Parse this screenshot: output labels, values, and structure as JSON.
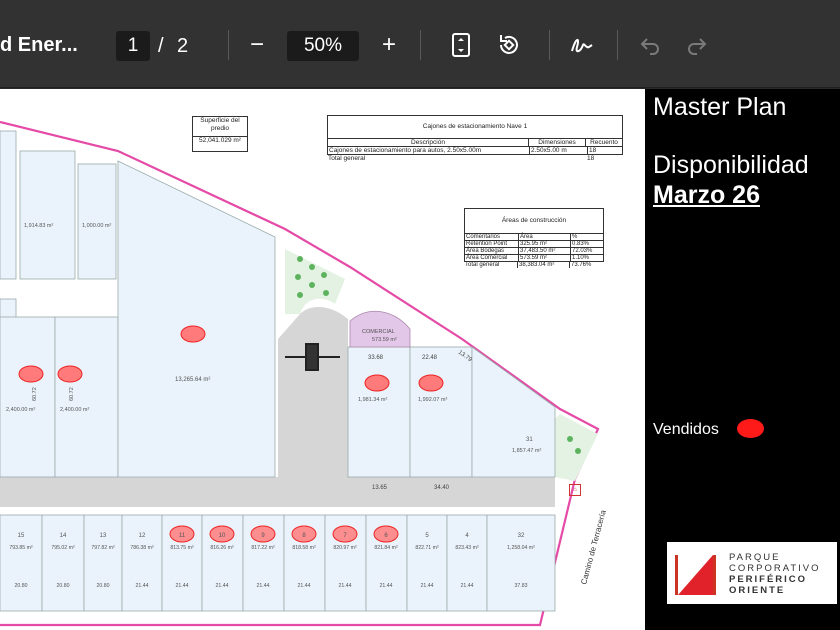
{
  "toolbar": {
    "doc_title": "d Ener...",
    "page_current": "1",
    "page_separator": "/",
    "page_total": "2",
    "zoom_out": "−",
    "zoom": "50%",
    "zoom_in": "+"
  },
  "panel": {
    "title": "Master Plan",
    "availability": "Disponibilidad",
    "date": "Marzo 26",
    "sold_label": "Vendidos",
    "sold_color": "#ff1a1a",
    "logo_lines": [
      "PARQUE",
      "CORPORATIVO",
      "PERIFÉRICO",
      "ORIENTE"
    ]
  },
  "plan": {
    "surface_label_1": "Superficie del",
    "surface_label_2": "predio",
    "surface_value": "52,041.029 m²",
    "parking": {
      "title": "Cajones de estacionamiento Nave 1",
      "headers": [
        "Descripción",
        "Dimensiones",
        "Recuento"
      ],
      "row": [
        "Cajones de estacionamiento para autos, 2.50x5.00m",
        "2.50x5.00 m",
        "18"
      ],
      "total_label": "Total general",
      "total_value": "18"
    },
    "areas": {
      "title": "Áreas de construcción",
      "headers": [
        "Comentarios",
        "Área",
        "%"
      ],
      "rows": [
        [
          "Retention Point",
          "325.95 m²",
          "0.83%"
        ],
        [
          "Área Bodegas",
          "37,483.50 m²",
          "72.03%"
        ],
        [
          "Área Comercial",
          "573.59 m²",
          "1.10%"
        ]
      ],
      "total": [
        "Total general",
        "38,383.04 m²",
        "73.76%"
      ]
    },
    "top_lots": [
      {
        "area": "1,914.83 m²"
      },
      {
        "area": "1,000.00 m²"
      }
    ],
    "mid_lots": [
      {
        "area": "2,400.00 m²",
        "dim": "60.72"
      },
      {
        "area": "2,400.00 m²",
        "dim": "60.72"
      },
      {
        "area": "13,265.64 m²",
        "dim": ""
      }
    ],
    "commercial": {
      "label": "COMERCIAL",
      "area": "573.59 m²"
    },
    "right_lots": [
      {
        "area": "1,981.34 m²",
        "dim": "33.68"
      },
      {
        "area": "1,992.07 m²",
        "dim": "22.48"
      },
      {
        "num": "31",
        "area": "1,857.47 m²"
      }
    ],
    "bottom_lots": [
      {
        "num": "15",
        "area": "793.85 m²",
        "w": "20.80",
        "sold": false
      },
      {
        "num": "14",
        "area": "795.02 m²",
        "w": "20.80",
        "sold": false
      },
      {
        "num": "13",
        "area": "797.82 m²",
        "w": "20.80",
        "sold": false
      },
      {
        "num": "12",
        "area": "786.38 m²",
        "w": "21.44",
        "sold": false
      },
      {
        "num": "11",
        "area": "813.75 m²",
        "w": "21.44",
        "sold": true
      },
      {
        "num": "10",
        "area": "816.26 m²",
        "w": "21.44",
        "sold": true
      },
      {
        "num": "9",
        "area": "817.22 m²",
        "w": "21.44",
        "sold": true
      },
      {
        "num": "8",
        "area": "818.58 m²",
        "w": "21.44",
        "sold": true
      },
      {
        "num": "7",
        "area": "820.97 m²",
        "w": "21.44",
        "sold": true
      },
      {
        "num": "6",
        "area": "821.84 m²",
        "w": "21.44",
        "sold": true
      },
      {
        "num": "5",
        "area": "822.71 m²",
        "w": "21.44",
        "sold": false
      },
      {
        "num": "4",
        "area": "823.43 m²",
        "w": "21.44",
        "sold": false
      },
      {
        "num": "32",
        "area": "1,258.04 m²",
        "w": "37.83",
        "sold": false
      }
    ],
    "road_label": "Camino de Terracería",
    "dims": [
      "13.65",
      "34.40",
      "33.68",
      "22.48",
      "13.79"
    ]
  }
}
